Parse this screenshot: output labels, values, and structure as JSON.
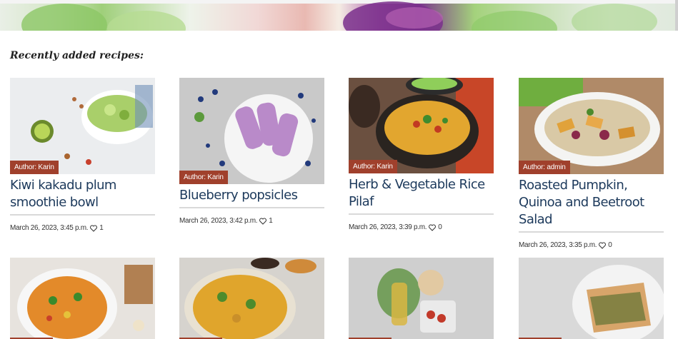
{
  "section": {
    "title": "Recently added recipes:"
  },
  "recipes": [
    {
      "author": "Author: Karin",
      "title": "Kiwi kakadu plum smoothie bowl",
      "date": "March 26, 2023, 3:45 p.m.",
      "likes": "1"
    },
    {
      "author": "Author: Karin",
      "title": "Blueberry popsicles",
      "date": "March 26, 2023, 3:42 p.m.",
      "likes": "1"
    },
    {
      "author": "Author: Karin",
      "title": "Herb & Vegetable Rice Pilaf",
      "date": "March 26, 2023, 3:39 p.m.",
      "likes": "0"
    },
    {
      "author": "Author: admin",
      "title": "Roasted Pumpkin, Quinoa and Beetroot Salad",
      "date": "March 26, 2023, 3:35 p.m.",
      "likes": "0"
    }
  ],
  "colors": {
    "author_badge": "#a0402c",
    "title": "#1d3a5c"
  },
  "icons": {
    "like": "heart-icon"
  }
}
